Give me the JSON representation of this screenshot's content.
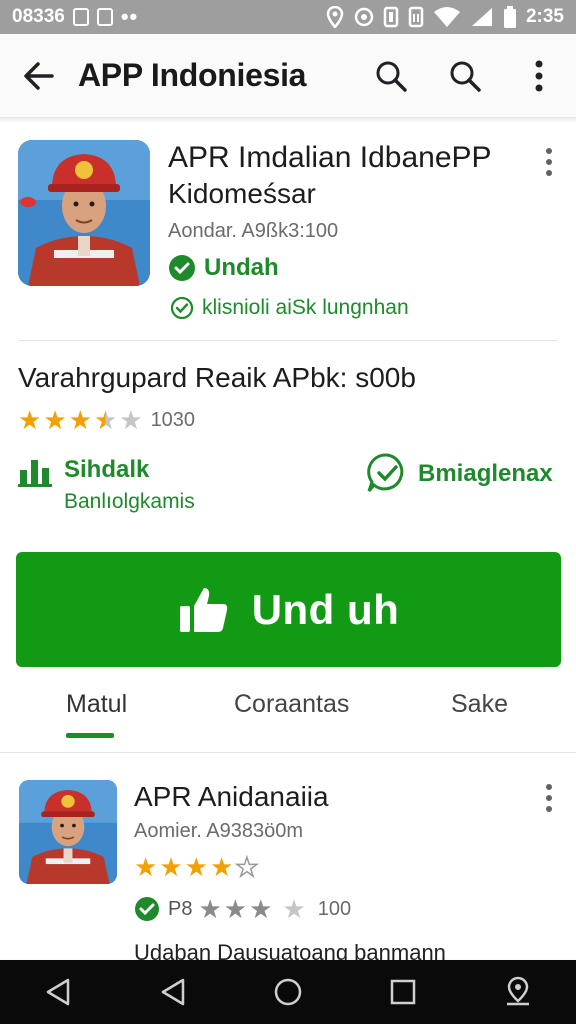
{
  "status_bar": {
    "left_text": "08336",
    "time": "2:35"
  },
  "app_bar": {
    "title": "APP Indoniesia",
    "back_icon": "arrow-left-icon",
    "search_icon": "search-icon",
    "more_icon": "more-vert-icon"
  },
  "main_app": {
    "title": "APR Imdalian IdbanePP",
    "subtitle": "Kidomeśsar",
    "meta": "Aondar. A9ßk3:100",
    "install_state": "Undah",
    "verified_text": "klisnioli aiSk lungnhan"
  },
  "details": {
    "headline": "Varahrgupard Reaik APbk: s00b",
    "rating_value": 3.5,
    "rating_count": "1030",
    "feature_left": {
      "title": "Sihdalk",
      "subtitle": "Banlıolgkamis",
      "icon": "bar-chart-icon"
    },
    "feature_right": {
      "title": "Bmiaglenax",
      "icon": "verified-chat-icon"
    }
  },
  "install_button": {
    "label": "Und uh",
    "icon": "thumbs-up-icon"
  },
  "tabs": [
    {
      "label": "Matul",
      "active": true
    },
    {
      "label": "Coraantas",
      "active": false
    },
    {
      "label": "Sake",
      "active": false
    }
  ],
  "related_app": {
    "title": "APR Anidanaiia",
    "meta": "Aomier. A9383ö0m",
    "rating_value": 4.5,
    "badge": "P8",
    "secondary_rating_value": 3,
    "secondary_count": "100",
    "description": "Udaban Dausuatoang banmann"
  },
  "colors": {
    "accent_green": "#1e8a2c",
    "install_green": "#139a14",
    "star_gold": "#f4a100",
    "nav_bar": "#0a0a0a"
  }
}
